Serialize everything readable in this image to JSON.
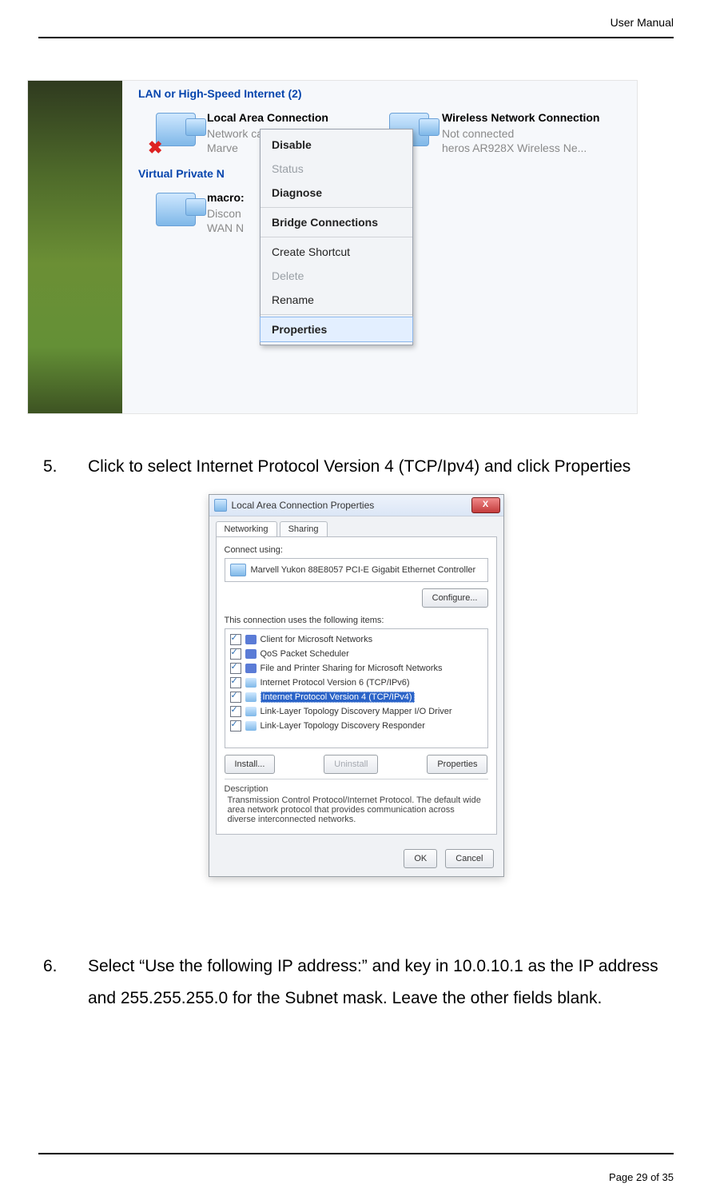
{
  "doc": {
    "header_title": "User Manual",
    "page_label": "Page 29 of 35"
  },
  "steps": {
    "s5_num": "5.",
    "s5_text": "Click to select Internet Protocol Version 4 (TCP/Ipv4) and click Properties",
    "s6_num": "6.",
    "s6_text": "Select “Use the following IP address:” and key in 10.0.10.1 as the IP address and 255.255.255.0 for the Subnet mask. Leave the other fields blank."
  },
  "fig1": {
    "group_lan": "LAN or High-Speed Internet (2)",
    "group_vpn": "Virtual Private N",
    "lan1": {
      "title": "Local Area Connection",
      "status": "Network cable unplugged",
      "adapter": "Marve"
    },
    "lan2": {
      "title": "Wireless Network Connection",
      "status": "Not connected",
      "adapter": "heros AR928X Wireless Ne..."
    },
    "vpn": {
      "title": "macro:",
      "status": "Discon",
      "adapter": "WAN N"
    },
    "menu": {
      "disable": "Disable",
      "status": "Status",
      "diagnose": "Diagnose",
      "bridge": "Bridge Connections",
      "shortcut": "Create Shortcut",
      "delete": "Delete",
      "rename": "Rename",
      "properties": "Properties"
    }
  },
  "fig2": {
    "title": "Local Area Connection Properties",
    "close_glyph": "X",
    "tab_networking": "Networking",
    "tab_sharing": "Sharing",
    "connect_using_label": "Connect using:",
    "adapter": "Marvell Yukon 88E8057 PCI-E Gigabit Ethernet Controller",
    "btn_configure": "Configure...",
    "items_label": "This connection uses the following items:",
    "items": [
      "Client for Microsoft Networks",
      "QoS Packet Scheduler",
      "File and Printer Sharing for Microsoft Networks",
      "Internet Protocol Version 6 (TCP/IPv6)",
      "Internet Protocol Version 4 (TCP/IPv4)",
      "Link-Layer Topology Discovery Mapper I/O Driver",
      "Link-Layer Topology Discovery Responder"
    ],
    "btn_install": "Install...",
    "btn_uninstall": "Uninstall",
    "btn_properties": "Properties",
    "desc_label": "Description",
    "desc_text": "Transmission Control Protocol/Internet Protocol. The default wide area network protocol that provides communication across diverse interconnected networks.",
    "btn_ok": "OK",
    "btn_cancel": "Cancel"
  }
}
